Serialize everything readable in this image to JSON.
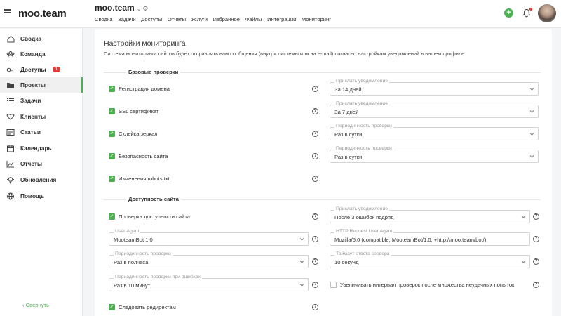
{
  "header": {
    "logo": "moo.team",
    "project_title": "moo.team",
    "nav": [
      "Сводка",
      "Задачи",
      "Доступы",
      "Отчеты",
      "Услуги",
      "Избранное",
      "Файлы",
      "Интеграции",
      "Мониторинг"
    ],
    "add_icon": "plus-icon",
    "bell_icon": "bell-icon"
  },
  "sidebar": {
    "items": [
      {
        "label": "Сводка",
        "icon": "home-icon"
      },
      {
        "label": "Команда",
        "icon": "team-icon"
      },
      {
        "label": "Доступы",
        "icon": "key-icon",
        "badge": "1"
      },
      {
        "label": "Проекты",
        "icon": "folder-icon",
        "active": true
      },
      {
        "label": "Задачи",
        "icon": "tasks-icon"
      },
      {
        "label": "Клиенты",
        "icon": "clients-icon"
      },
      {
        "label": "Статьи",
        "icon": "articles-icon"
      },
      {
        "label": "Календарь",
        "icon": "calendar-icon"
      },
      {
        "label": "Отчёты",
        "icon": "chart-icon"
      },
      {
        "label": "Обновления",
        "icon": "bulb-icon"
      },
      {
        "label": "Помощь",
        "icon": "globe-icon"
      }
    ],
    "collapse_label": "Свернуть"
  },
  "main": {
    "title": "Настройки мониторинга",
    "description": "Система мониторинга сайтов будет отправлять вам сообщения (внутри системы или на e-mail) согласно настройкам уведомлений в вашем профиле.",
    "basic_section": "Базовые проверки",
    "basic_checks": [
      {
        "label": "Регистрация домена",
        "checked": true,
        "field_label": "Прислать уведомление",
        "field_value": "За 14 дней"
      },
      {
        "label": "SSL сертификат",
        "checked": true,
        "field_label": "Прислать уведомление",
        "field_value": "За 7 дней"
      },
      {
        "label": "Склейка зеркал",
        "checked": true,
        "field_label": "Периодичность проверки",
        "field_value": "Раз в сутки"
      },
      {
        "label": "Безопасность сайта",
        "checked": true,
        "field_label": "Периодичность проверки",
        "field_value": "Раз в сутки"
      },
      {
        "label": "Изменения robots.txt",
        "checked": true
      }
    ],
    "availability_section": "Доступность сайта",
    "availability_check": {
      "label": "Проверка доступности сайта",
      "checked": true
    },
    "notify_field": {
      "label": "Прислать уведомление",
      "value": "После 3 ошибок подряд"
    },
    "user_agent_field": {
      "label": "User-Agent",
      "value": "MooteamBot 1.0"
    },
    "http_user_agent_field": {
      "label": "HTTP Request User Agent",
      "value": "Mozilla/5.0 (compatible; MooteamBot/1.0; +http://moo.team/bot/)"
    },
    "frequency_field": {
      "label": "Периодичность проверки",
      "value": "Раз в полчаса"
    },
    "timeout_field": {
      "label": "Таймаут ответа сервера",
      "value": "10 секунд"
    },
    "error_frequency_field": {
      "label": "Периодичность проверки при ошибках",
      "value": "Раз в 10 минут"
    },
    "increase_interval": {
      "label": "Увеличивать интервал проверок после множества неудачных попыток",
      "checked": false
    },
    "follow_redirects": {
      "label": "Следовать редиректам",
      "checked": true
    }
  },
  "colors": {
    "accent": "#4caf50",
    "badge": "#e53935"
  }
}
